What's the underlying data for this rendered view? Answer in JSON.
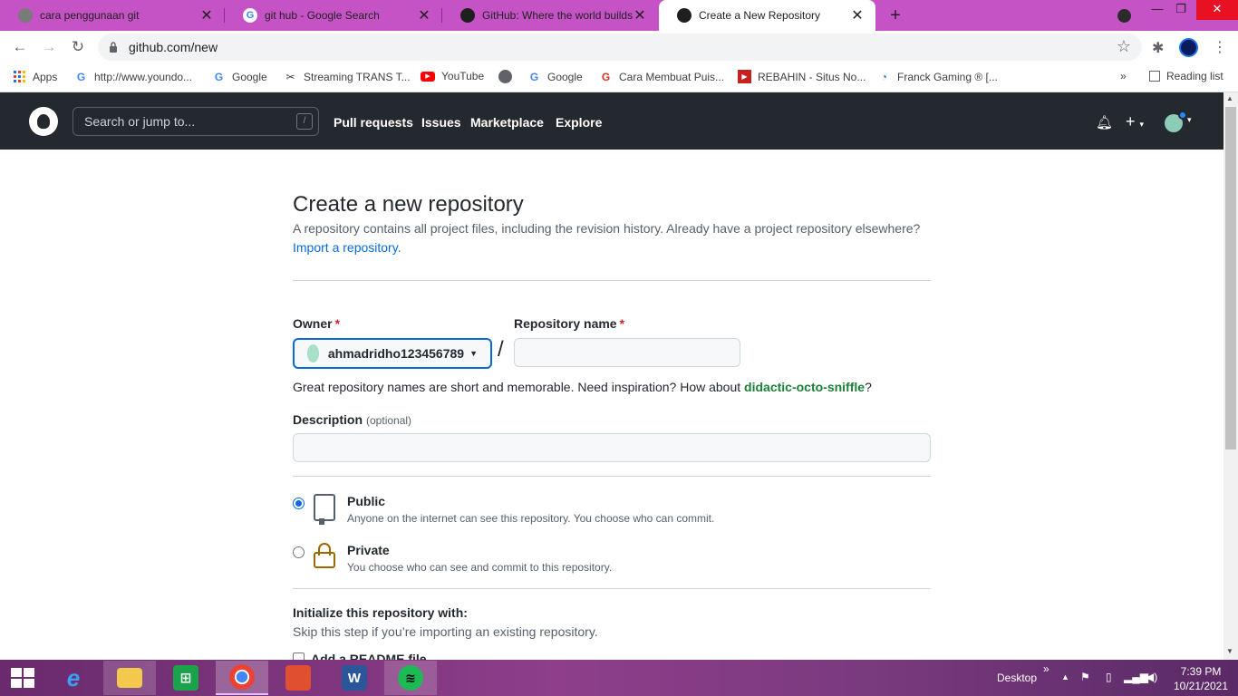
{
  "browser": {
    "tabs": [
      {
        "title": "cara penggunaan git",
        "active": false
      },
      {
        "title": "git hub - Google Search",
        "active": false
      },
      {
        "title": "GitHub: Where the world builds s",
        "active": false
      },
      {
        "title": "Create a New Repository",
        "active": true
      }
    ],
    "tab_close": "✕",
    "new_tab": "+",
    "window_controls": {
      "minimize": "—",
      "maximize": "❐",
      "close": "✕"
    },
    "url": "github.com/new",
    "bookmarks": [
      {
        "label": "Apps",
        "icon": "apps-grid-icon"
      },
      {
        "label": "http://www.youndo...",
        "icon": "google-icon"
      },
      {
        "label": "Google",
        "icon": "google-icon"
      },
      {
        "label": "Streaming TRANS T...",
        "icon": "trans-tv-icon"
      },
      {
        "label": "YouTube",
        "icon": "youtube-icon"
      },
      {
        "label": "",
        "icon": "globe-icon"
      },
      {
        "label": "Google",
        "icon": "google-icon"
      },
      {
        "label": "Cara Membuat Puis...",
        "icon": "google-g-icon"
      },
      {
        "label": "REBAHIN - Situs No...",
        "icon": "rebahin-icon"
      },
      {
        "label": "Franck Gaming ® [...",
        "icon": "franck-gaming-icon"
      }
    ],
    "bookmarks_overflow": "»",
    "reading_list": "Reading list"
  },
  "github_header": {
    "search_placeholder": "Search or jump to...",
    "search_shortcut": "/",
    "nav": [
      "Pull requests",
      "Issues",
      "Marketplace",
      "Explore"
    ]
  },
  "form": {
    "title": "Create a new repository",
    "subtitle": "A repository contains all project files, including the revision history. Already have a project repository elsewhere?",
    "import_link": "Import a repository.",
    "owner_label": "Owner",
    "owner_value": "ahmadridho123456789",
    "required_mark": "*",
    "separator": "/",
    "repo_name_label": "Repository name",
    "repo_name_value": "",
    "hint_prefix": "Great repository names are short and memorable. Need inspiration? How about",
    "hint_suggestion": "didactic-octo-sniffle",
    "hint_suffix": "?",
    "description_label": "Description",
    "description_optional": "(optional)",
    "description_value": "",
    "visibility": [
      {
        "title": "Public",
        "desc": "Anyone on the internet can see this repository. You choose who can commit.",
        "checked": true
      },
      {
        "title": "Private",
        "desc": "You choose who can see and commit to this repository.",
        "checked": false
      }
    ],
    "init_title": "Initialize this repository with:",
    "init_sub": "Skip this step if you’re importing an existing repository.",
    "readme_label": "Add a README file"
  },
  "taskbar": {
    "apps": [
      "internet-explorer",
      "file-explorer",
      "microsoft-store",
      "google-chrome",
      "game-app",
      "microsoft-word",
      "spotify"
    ],
    "active_app": "google-chrome",
    "desktop_label": "Desktop",
    "tray_overflow": "»",
    "time": "7:39 PM",
    "date": "10/21/2021"
  },
  "colors": {
    "tab_strip": "#c653c6",
    "github_header": "#24292f",
    "link_blue": "#0969da",
    "suggestion_green": "#1a7f37",
    "required_red": "#cf222e"
  }
}
